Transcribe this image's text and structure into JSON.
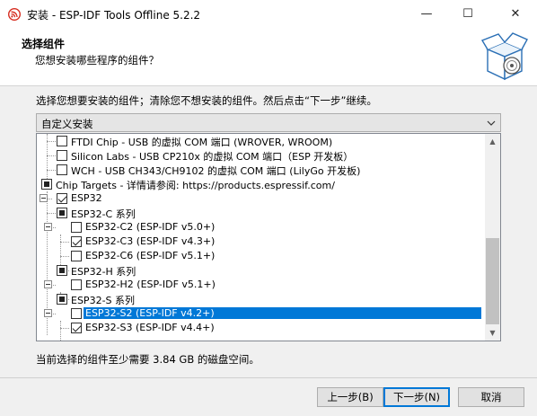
{
  "window": {
    "title": "安装 - ESP-IDF Tools Offline 5.2.2",
    "min_glyph": "—",
    "max_glyph": "☐",
    "close_glyph": "✕"
  },
  "header": {
    "title": "选择组件",
    "subtitle": "您想安装哪些程序的组件？"
  },
  "instruction": "选择您想要安装的组件；清除您不想安装的组件。然后点击“下一步”继续。",
  "install_type": {
    "selected": "自定义安装"
  },
  "tree": [
    {
      "label": "FTDI Chip - USB 的虚拟 COM 端口 (WROVER, WROOM)",
      "state": "unchecked"
    },
    {
      "label": "Silicon Labs - USB CP210x 的虚拟 COM 端口（ESP 开发板）",
      "state": "unchecked"
    },
    {
      "label": "WCH - USB CH343/CH9102 的虚拟 COM 端口 (LilyGo  开发板)",
      "state": "unchecked"
    },
    {
      "label": "Chip Targets - 详情请参阅: https://products.espressif.com/",
      "state": "partial"
    },
    {
      "label": "ESP32",
      "state": "checked"
    },
    {
      "label": "ESP32-C 系列",
      "state": "partial"
    },
    {
      "label": "ESP32-C2 (ESP-IDF v5.0+)",
      "state": "unchecked"
    },
    {
      "label": "ESP32-C3 (ESP-IDF v4.3+)",
      "state": "checked"
    },
    {
      "label": "ESP32-C6 (ESP-IDF v5.1+)",
      "state": "unchecked"
    },
    {
      "label": "ESP32-H 系列",
      "state": "partial"
    },
    {
      "label": "ESP32-H2 (ESP-IDF v5.1+)",
      "state": "unchecked"
    },
    {
      "label": "ESP32-S 系列",
      "state": "partial"
    },
    {
      "label": "ESP32-S2 (ESP-IDF v4.2+)",
      "state": "unchecked",
      "selected": true
    },
    {
      "label": "ESP32-S3 (ESP-IDF v4.4+)",
      "state": "checked"
    }
  ],
  "space_required": "当前选择的组件至少需要 3.84 GB 的磁盘空间。",
  "buttons": {
    "back": "上一步(B)",
    "next": "下一步(N)",
    "cancel": "取消"
  },
  "colors": {
    "selection": "#0078d7",
    "brand_red": "#d62d20"
  }
}
